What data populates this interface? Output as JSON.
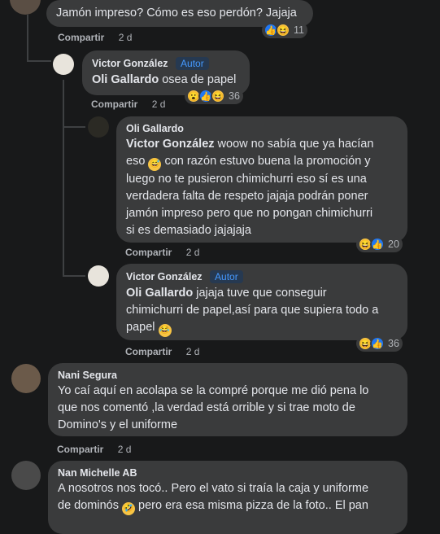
{
  "comments": [
    {
      "text": "Jamón impreso? Cómo es eso perdón? Jajaja",
      "share": "Compartir",
      "time": "2 d",
      "reactions": [
        "like",
        "haha"
      ],
      "count": "11"
    },
    {
      "author": "Victor González",
      "badge": "Autor",
      "tag": "Oli Gallardo",
      "text": " osea de papel",
      "share": "Compartir",
      "time": "2 d",
      "reactions": [
        "wow",
        "like",
        "haha"
      ],
      "count": "36"
    },
    {
      "author": "Oli Gallardo",
      "tag": "Victor González",
      "text_lines": [
        " woow no sabía que ya hacían",
        "eso ",
        " con razón estuvo buena la promoción y",
        "luego no te pusieron chimichurri eso sí es una",
        "verdadera falta de respeto jajaja podrán poner",
        "jamón impreso pero que no pongan chimichurri",
        "si es demasiado jajajaja"
      ],
      "share": "Compartir",
      "time": "2 d",
      "reactions": [
        "haha",
        "like"
      ],
      "count": "20"
    },
    {
      "author": "Victor González",
      "badge": "Autor",
      "tag": "Oli Gallardo",
      "text_lines": [
        " jajaja tuve que conseguir",
        "chimichurri de papel,así para que supiera todo a",
        "papel "
      ],
      "share": "Compartir",
      "time": "2 d",
      "reactions": [
        "haha",
        "like"
      ],
      "count": "36"
    },
    {
      "author": "Nani Segura",
      "text_lines": [
        "Yo caí aquí en acolapa se la compré porque me dió pena lo",
        "que nos comentó ,la verdad está orrible y si trae moto de",
        "Domino's y el uniforme"
      ],
      "share": "Compartir",
      "time": "2 d"
    },
    {
      "author": "Nan Michelle AB",
      "text_lines": [
        "A nosotros nos tocó.. Pero el vato si traía la caja y uniforme",
        "de dominós ",
        " pero era esa misma pizza de la foto.. El pan"
      ]
    }
  ],
  "colors": {
    "background": "#18191a",
    "bubble": "#3a3b3c",
    "like": "#2078f4",
    "haha": "#f7c444",
    "badge": "#4599ff"
  }
}
